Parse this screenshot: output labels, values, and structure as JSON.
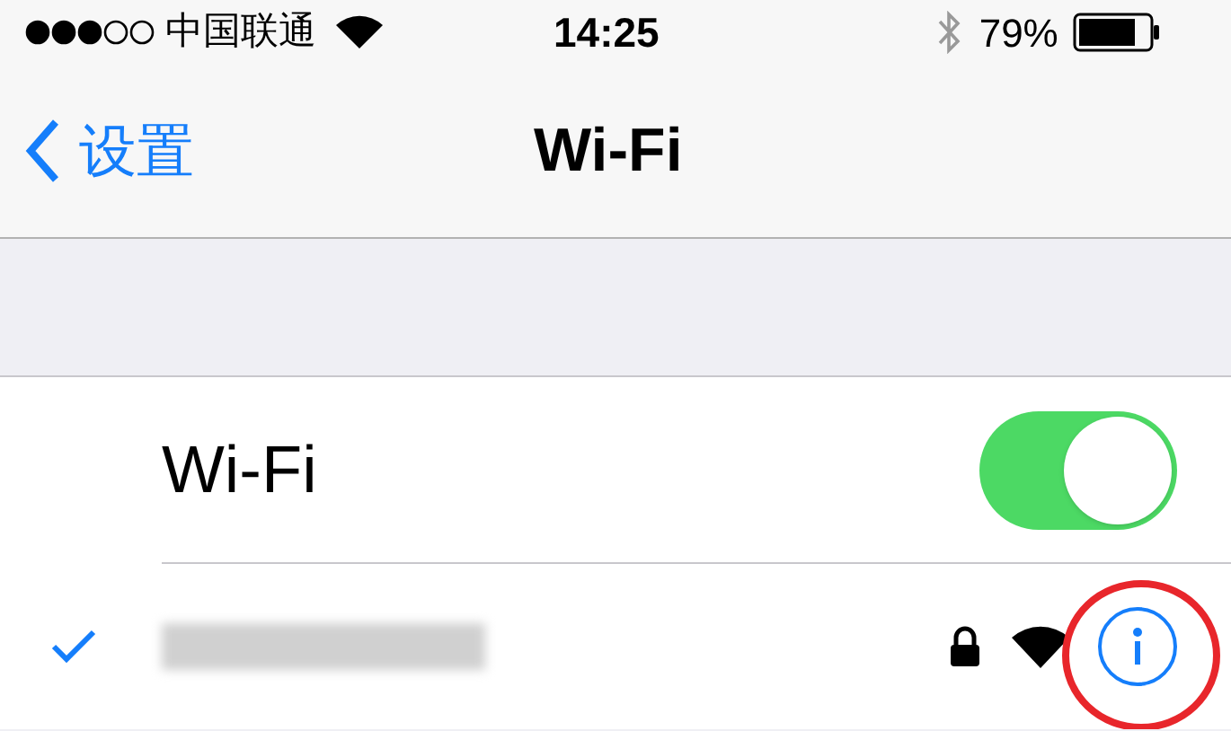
{
  "status_bar": {
    "carrier": "中国联通",
    "time": "14:25",
    "battery": "79%"
  },
  "nav": {
    "back": "设置",
    "title": "Wi-Fi"
  },
  "wifi": {
    "label": "Wi-Fi",
    "on": true
  },
  "networks": [
    {
      "selected": true,
      "locked": true
    }
  ]
}
